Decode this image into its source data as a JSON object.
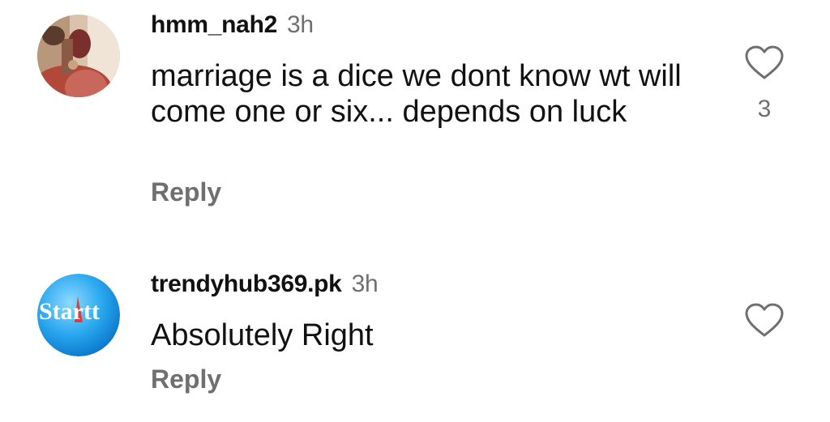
{
  "comments": [
    {
      "username": "hmm_nah2",
      "time": "3h",
      "text": "marriage is a dice we dont know wt will come one or six... depends on luck",
      "reply_label": "Reply",
      "like_icon": "heart-outline-icon",
      "like_count": "3"
    },
    {
      "username": "trendyhub369.pk",
      "time": "3h",
      "text": "Absolutely Right",
      "reply_label": "Reply",
      "like_icon": "heart-outline-icon",
      "avatar_logo_text": "Startt"
    }
  ]
}
